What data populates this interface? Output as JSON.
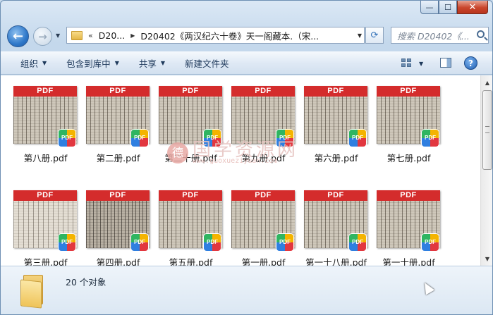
{
  "window": {
    "caption_buttons": {
      "minimize": "—",
      "maximize": "☐",
      "close": "✕"
    }
  },
  "nav": {
    "back_glyph": "←",
    "forward_glyph": "→",
    "dropdown_glyph": "▼",
    "breadcrumb": {
      "overflow": "«",
      "items": [
        "D20...",
        "D20402《两汉纪六十卷》天一阁藏本.（宋..."
      ],
      "separator": "▶"
    },
    "refresh_glyph": "⟳",
    "search_placeholder": "搜索 D20402《..."
  },
  "toolbar": {
    "items": [
      {
        "label": "组织",
        "has_dropdown": true
      },
      {
        "label": "包含到库中",
        "has_dropdown": true
      },
      {
        "label": "共享",
        "has_dropdown": true
      },
      {
        "label": "新建文件夹",
        "has_dropdown": false
      }
    ],
    "dropdown_glyph": "▼",
    "help_label": "?"
  },
  "files": {
    "band_label": "PDF",
    "badge_label": "PDF",
    "items": [
      {
        "name": "第八册.pdf",
        "tone": "normal"
      },
      {
        "name": "第二册.pdf",
        "tone": "normal"
      },
      {
        "name": "第二十册.pdf",
        "tone": "normal"
      },
      {
        "name": "第九册.pdf",
        "tone": "normal"
      },
      {
        "name": "第六册.pdf",
        "tone": "normal"
      },
      {
        "name": "第七册.pdf",
        "tone": "normal"
      },
      {
        "name": "第三册.pdf",
        "tone": "light"
      },
      {
        "name": "第四册.pdf",
        "tone": "dark"
      },
      {
        "name": "第五册.pdf",
        "tone": "normal"
      },
      {
        "name": "第一册.pdf",
        "tone": "normal"
      },
      {
        "name": "第一十八册.pdf",
        "tone": "normal"
      },
      {
        "name": "第一十册.pdf",
        "tone": "normal"
      }
    ]
  },
  "watermark": {
    "seal": "德",
    "text": "国学资源网",
    "url": "www.guoxueziyuan.com"
  },
  "details": {
    "count_text": "20 个对象"
  },
  "colors": {
    "pdf_band": "#d42c2c",
    "window_frame": "#c4d8ec",
    "content_bg": "#ffffff"
  }
}
